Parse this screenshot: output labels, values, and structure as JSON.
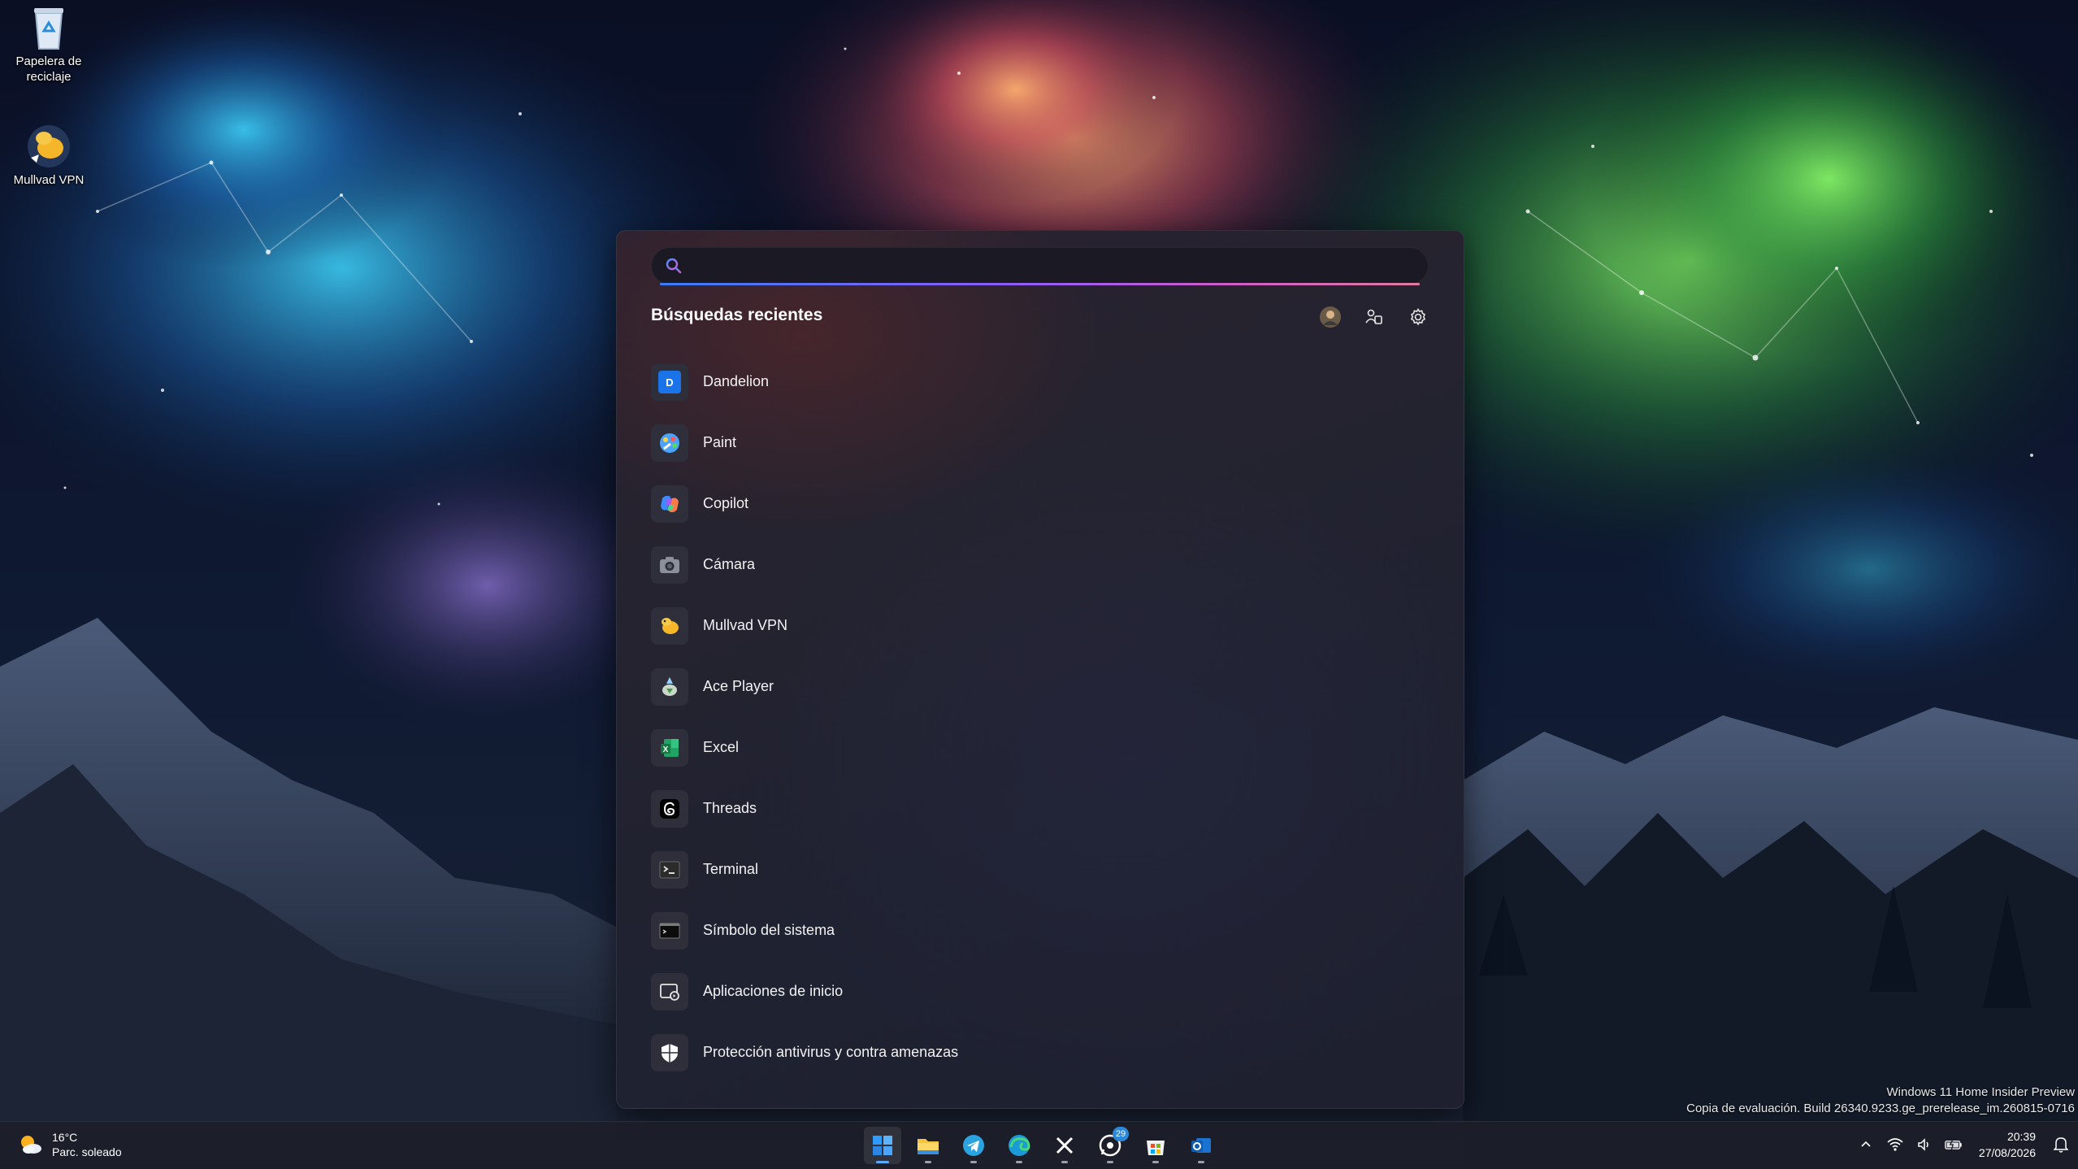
{
  "desktop": {
    "icons": [
      {
        "label": "Papelera de reciclaje",
        "icon": "recycle-bin-icon"
      },
      {
        "label": "Mullvad VPN",
        "icon": "mullvad-vpn-icon"
      }
    ]
  },
  "search": {
    "placeholder": "",
    "value": "",
    "recent_title": "Búsquedas recientes",
    "header_icons": [
      "profile-avatar",
      "connected-accounts-icon",
      "settings-gear-icon"
    ],
    "results": [
      {
        "label": "Dandelion",
        "icon": "dandelion-app-icon"
      },
      {
        "label": "Paint",
        "icon": "paint-app-icon"
      },
      {
        "label": "Copilot",
        "icon": "copilot-app-icon"
      },
      {
        "label": "Cámara",
        "icon": "camera-app-icon"
      },
      {
        "label": "Mullvad VPN",
        "icon": "mullvad-vpn-icon"
      },
      {
        "label": "Ace Player",
        "icon": "ace-player-icon"
      },
      {
        "label": "Excel",
        "icon": "excel-app-icon"
      },
      {
        "label": "Threads",
        "icon": "threads-app-icon"
      },
      {
        "label": "Terminal",
        "icon": "terminal-app-icon"
      },
      {
        "label": "Símbolo del sistema",
        "icon": "command-prompt-icon"
      },
      {
        "label": "Aplicaciones de inicio",
        "icon": "startup-apps-icon"
      },
      {
        "label": "Protección antivirus y contra amenazas",
        "icon": "shield-icon"
      }
    ]
  },
  "watermark": {
    "line1": "Windows 11 Home Insider Preview",
    "line2": "Copia de evaluación. Build 26340.9233.ge_prerelease_im.260815-0716"
  },
  "taskbar": {
    "weather": {
      "temp": "16°C",
      "condition": "Parc. soleado"
    },
    "apps": [
      {
        "name": "Inicio",
        "icon": "windows-start-icon",
        "active": true
      },
      {
        "name": "Explorador de archivos",
        "icon": "file-explorer-icon"
      },
      {
        "name": "Telegram",
        "icon": "telegram-icon"
      },
      {
        "name": "Microsoft Edge",
        "icon": "edge-browser-icon"
      },
      {
        "name": "X",
        "icon": "x-app-icon"
      },
      {
        "name": "WhatsApp",
        "icon": "whatsapp-icon",
        "badge": "29"
      },
      {
        "name": "Microsoft Store",
        "icon": "store-icon"
      },
      {
        "name": "Outlook",
        "icon": "outlook-icon"
      }
    ],
    "tray": {
      "time": "20:39",
      "date": "27/08/2026"
    }
  },
  "colors": {
    "accent": "#5ca8ff",
    "panel_bg": "#24232f",
    "badge": "#2b87d8"
  }
}
